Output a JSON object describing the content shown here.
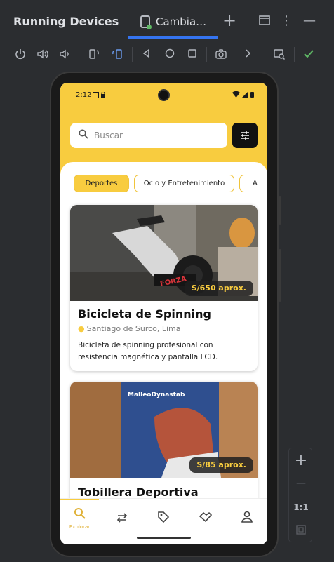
{
  "header": {
    "title": "Running Devices",
    "tab_label": "Cambia…",
    "add_label": "+",
    "more_label": "⋮",
    "minimize_label": "—"
  },
  "device": {
    "time": "2:12",
    "search_placeholder": "Buscar",
    "categories": [
      "Deportes",
      "Ocio y Entretenimiento",
      "A"
    ],
    "cards": [
      {
        "title": "Bicicleta de Spinning",
        "location": "Santiago de Surco, Lima",
        "price": "S/650 aprox.",
        "description": "Bicicleta de spinning profesional con resistencia magnética y pantalla LCD.",
        "brand_text": "FORZA"
      },
      {
        "title": "Tobillera Deportiva",
        "price": "S/85 aprox.",
        "brand_text": "MalleoDynastab"
      }
    ],
    "nav": {
      "explore_label": "Explorar"
    }
  },
  "zoom": {
    "plus": "+",
    "minus": "—",
    "ratio": "1:1"
  },
  "colors": {
    "accent": "#f8cc3f",
    "ide_bg": "#2b2d30",
    "ide_accent": "#3574f0"
  }
}
